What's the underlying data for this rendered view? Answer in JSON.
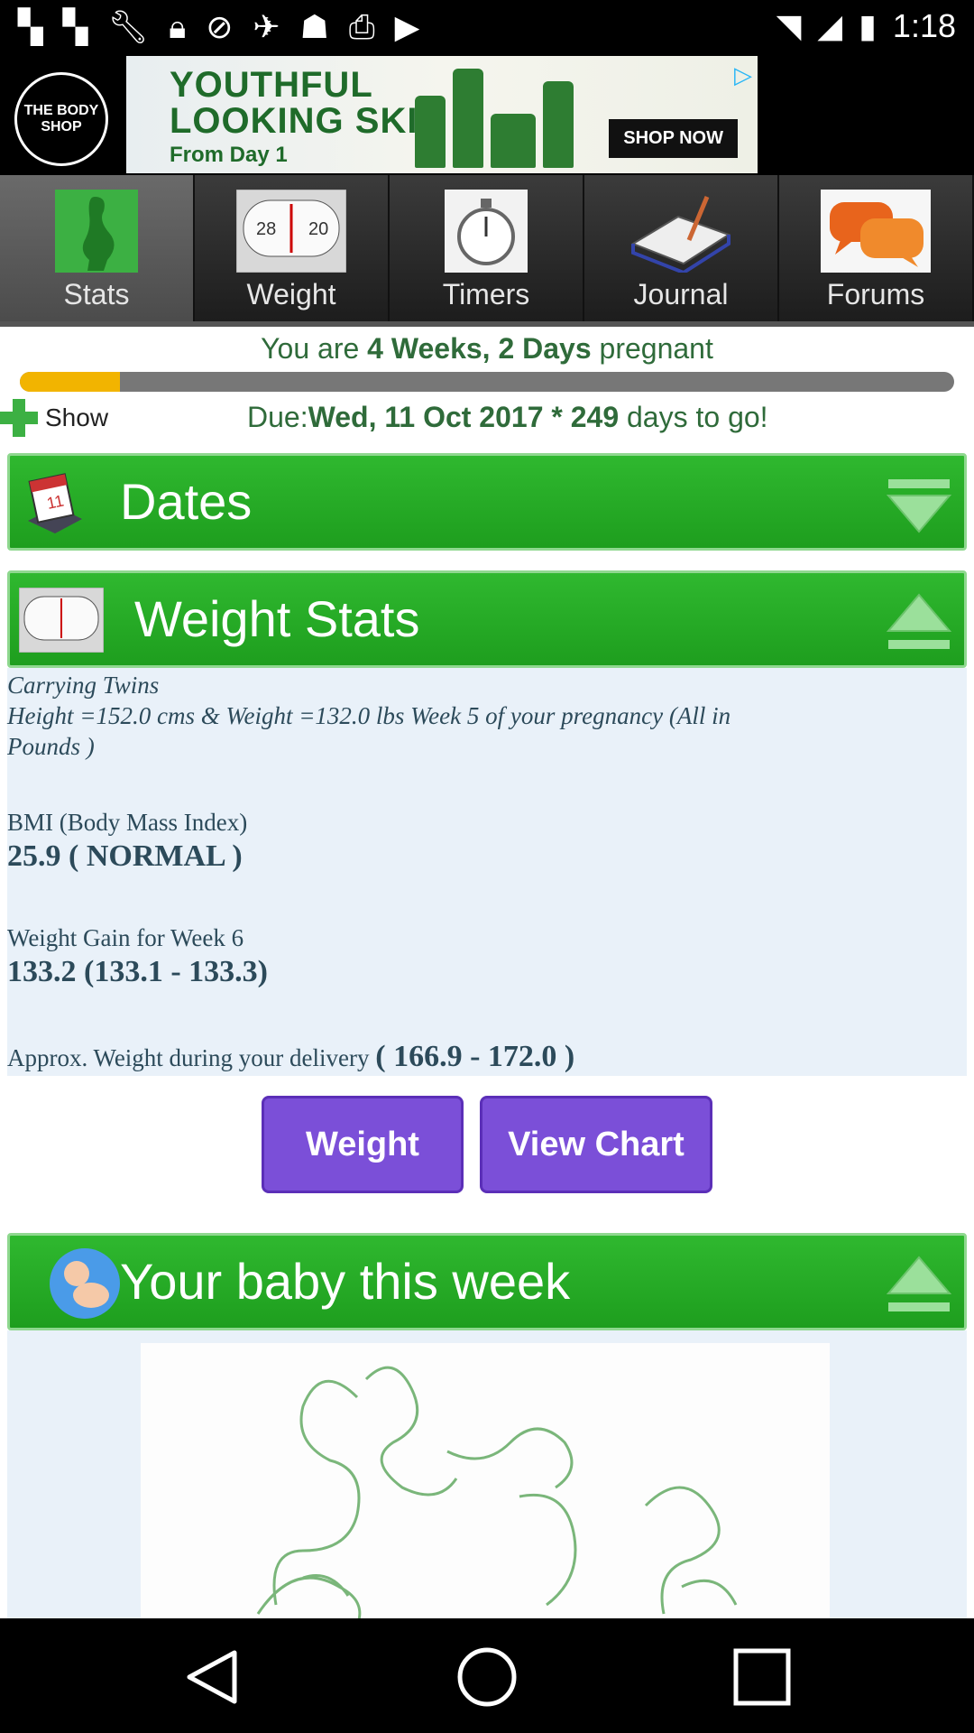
{
  "status_bar": {
    "left_icons": [
      "flipboard-icon",
      "flipboard-icon",
      "wrench-icon",
      "lock-icon",
      "clock-icon",
      "fake-gps-icon",
      "ghost-icon",
      "inbox-icon",
      "youtube-icon"
    ],
    "time": "1:18"
  },
  "ad": {
    "logo_text": "THE BODY SHOP",
    "headline_1": "YOUTHFUL",
    "headline_2": "LOOKING SKIN",
    "sub": "From Day 1",
    "cta": "SHOP NOW"
  },
  "tabs": [
    {
      "label": "Stats",
      "icon": "pregnant-icon",
      "active": true
    },
    {
      "label": "Weight",
      "icon": "scale-icon",
      "active": false
    },
    {
      "label": "Timers",
      "icon": "stopwatch-icon",
      "active": false
    },
    {
      "label": "Journal",
      "icon": "journal-icon",
      "active": false
    },
    {
      "label": "Forums",
      "icon": "chat-bubbles-icon",
      "active": false
    }
  ],
  "pregnancy": {
    "prefix": "You are ",
    "duration": "4 Weeks, 2 Days",
    "suffix": " pregnant",
    "progress_fraction": 0.107,
    "show_label": "Show",
    "due_label": "Due:",
    "due_date": "Wed, 11 Oct 2017 * 249",
    "due_suffix": " days to go!"
  },
  "sections": {
    "dates": "Dates",
    "weight_stats": "Weight Stats",
    "baby": "Your baby this week"
  },
  "weight_stats": {
    "line1": "Carrying Twins",
    "line2": "Height =152.0 cms & Weight =132.0 lbs Week 5 of your pregnancy (All in",
    "line3": "Pounds )",
    "bmi_label": "BMI (Body Mass Index)",
    "bmi_value": "25.9 ( NORMAL )",
    "gain_label": "Weight Gain for Week 6",
    "gain_value": "133.2 (133.1 - 133.3)",
    "delivery_label": "Approx. Weight during your delivery ",
    "delivery_value": "( 166.9 - 172.0 )"
  },
  "buttons": {
    "weight": "Weight",
    "view_chart": "View Chart"
  },
  "colors": {
    "section_green": "#22aa22",
    "button_purple": "#7b4fd8",
    "progress_fill": "#f2b400"
  }
}
